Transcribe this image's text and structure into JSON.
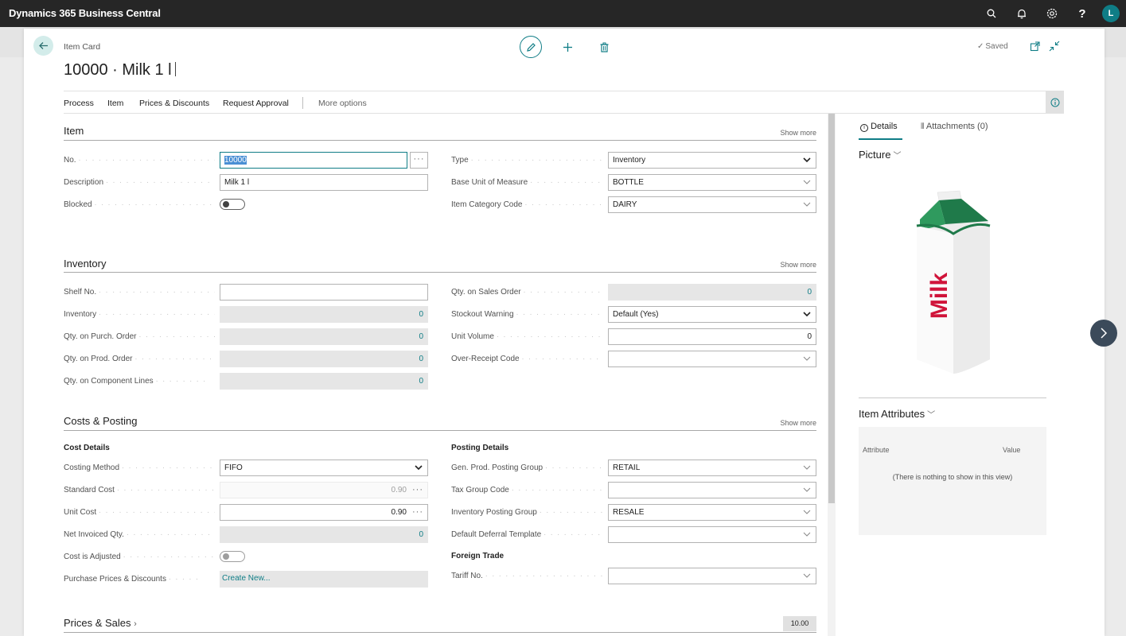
{
  "app": {
    "title": "Dynamics 365 Business Central",
    "avatar_initial": "L"
  },
  "page": {
    "caption": "Item Card",
    "title": "10000 · Milk 1 l",
    "saved": "Saved"
  },
  "actions": {
    "process": "Process",
    "item": "Item",
    "prices": "Prices & Discounts",
    "approval": "Request Approval",
    "more": "More options"
  },
  "sections": {
    "item": {
      "title": "Item",
      "show_more": "Show more"
    },
    "inventory": {
      "title": "Inventory",
      "show_more": "Show more"
    },
    "costs": {
      "title": "Costs & Posting",
      "show_more": "Show more"
    },
    "prices": {
      "title": "Prices & Sales",
      "value": "10.00"
    }
  },
  "item": {
    "no": {
      "label": "No.",
      "value": "10000"
    },
    "description": {
      "label": "Description",
      "value": "Milk 1 l"
    },
    "blocked": {
      "label": "Blocked",
      "value": false
    },
    "type": {
      "label": "Type",
      "value": "Inventory"
    },
    "base_uom": {
      "label": "Base Unit of Measure",
      "value": "BOTTLE"
    },
    "category": {
      "label": "Item Category Code",
      "value": "DAIRY"
    }
  },
  "inventory": {
    "shelf_no": {
      "label": "Shelf No.",
      "value": ""
    },
    "inventory": {
      "label": "Inventory",
      "value": "0"
    },
    "purch_order": {
      "label": "Qty. on Purch. Order",
      "value": "0"
    },
    "prod_order": {
      "label": "Qty. on Prod. Order",
      "value": "0"
    },
    "component": {
      "label": "Qty. on Component Lines",
      "value": "0"
    },
    "sales_order": {
      "label": "Qty. on Sales Order",
      "value": "0"
    },
    "stockout": {
      "label": "Stockout Warning",
      "value": "Default (Yes)"
    },
    "unit_volume": {
      "label": "Unit Volume",
      "value": "0"
    },
    "over_receipt": {
      "label": "Over-Receipt Code",
      "value": ""
    }
  },
  "costs": {
    "cost_details": "Cost Details",
    "posting_details": "Posting Details",
    "foreign_trade": "Foreign Trade",
    "costing_method": {
      "label": "Costing Method",
      "value": "FIFO"
    },
    "standard_cost": {
      "label": "Standard Cost",
      "value": "0.90"
    },
    "unit_cost": {
      "label": "Unit Cost",
      "value": "0.90"
    },
    "net_invoiced": {
      "label": "Net Invoiced Qty.",
      "value": "0"
    },
    "cost_adjusted": {
      "label": "Cost is Adjusted",
      "value": false
    },
    "purchase_prices": {
      "label": "Purchase Prices & Discounts",
      "value": "Create New..."
    },
    "gen_prod": {
      "label": "Gen. Prod. Posting Group",
      "value": "RETAIL"
    },
    "tax_group": {
      "label": "Tax Group Code",
      "value": ""
    },
    "inv_posting": {
      "label": "Inventory Posting Group",
      "value": "RESALE"
    },
    "deferral": {
      "label": "Default Deferral Template",
      "value": ""
    },
    "tariff": {
      "label": "Tariff No.",
      "value": ""
    }
  },
  "factbox": {
    "tab_details": "Details",
    "tab_attachments": "Attachments (0)",
    "picture_heading": "Picture",
    "picture_text": "Milk",
    "attributes_heading": "Item Attributes",
    "attr_col1": "Attribute",
    "attr_col2": "Value",
    "attr_empty": "(There is nothing to show in this view)"
  },
  "colors": {
    "accent": "#0f7d86",
    "topbar": "#262626",
    "readonly": "#e6e6e6",
    "milk_red": "#d0143a",
    "carton_green": "#1f7a4a"
  }
}
